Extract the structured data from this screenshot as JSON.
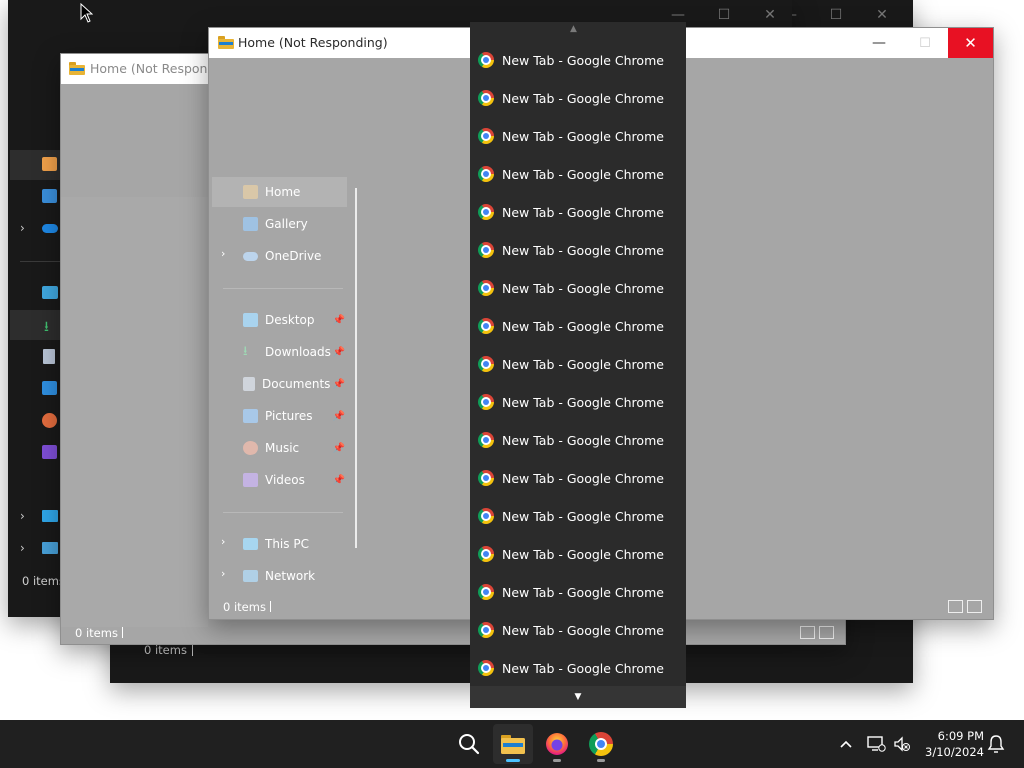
{
  "windows": {
    "back": {
      "title": "Home (Not Responding)",
      "status": "0 items"
    },
    "middle_status": "0 items",
    "rear_status": "0 items",
    "front": {
      "title": "Home (Not Responding)",
      "status": "0 items",
      "nav": [
        {
          "label": "Home",
          "icon": "home-icon",
          "pinned": false
        },
        {
          "label": "Gallery",
          "icon": "gallery-icon",
          "pinned": false
        },
        {
          "label": "OneDrive",
          "icon": "cloud-icon",
          "pinned": false
        }
      ],
      "quick": [
        {
          "label": "Desktop",
          "icon": "desktop-folder-icon"
        },
        {
          "label": "Downloads",
          "icon": "download-icon"
        },
        {
          "label": "Documents",
          "icon": "documents-icon"
        },
        {
          "label": "Pictures",
          "icon": "pictures-icon"
        },
        {
          "label": "Music",
          "icon": "music-icon"
        },
        {
          "label": "Videos",
          "icon": "videos-icon"
        }
      ],
      "devices": [
        {
          "label": "This PC",
          "icon": "this-pc-icon"
        },
        {
          "label": "Network",
          "icon": "network-icon"
        }
      ]
    }
  },
  "window_list": {
    "items": [
      "New Tab - Google Chrome",
      "New Tab - Google Chrome",
      "New Tab - Google Chrome",
      "New Tab - Google Chrome",
      "New Tab - Google Chrome",
      "New Tab - Google Chrome",
      "New Tab - Google Chrome",
      "New Tab - Google Chrome",
      "New Tab - Google Chrome",
      "New Tab - Google Chrome",
      "New Tab - Google Chrome",
      "New Tab - Google Chrome",
      "New Tab - Google Chrome",
      "New Tab - Google Chrome",
      "New Tab - Google Chrome",
      "New Tab - Google Chrome",
      "New Tab - Google Chrome"
    ]
  },
  "taskbar": {
    "time": "6:09 PM",
    "date": "3/10/2024",
    "accent": "#4cc2ff"
  },
  "colors": {
    "close_red": "#e81123",
    "list_bg": "#2b2b2b",
    "taskbar_bg": "#202020"
  }
}
